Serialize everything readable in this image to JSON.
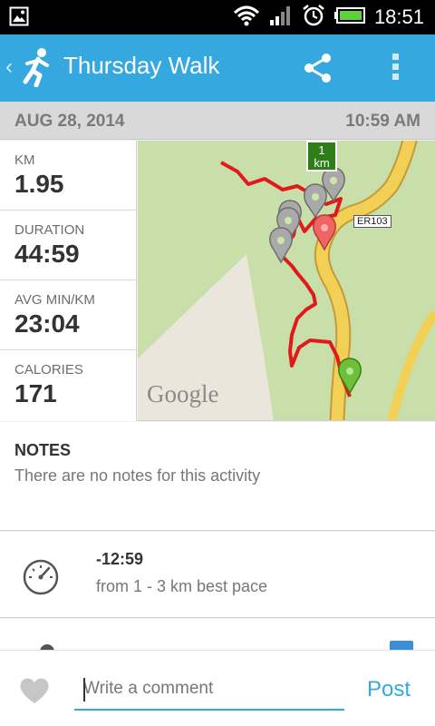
{
  "status_bar": {
    "time": "18:51",
    "icons": [
      "image-icon",
      "wifi-icon",
      "signal-icon",
      "alarm-icon",
      "battery-icon"
    ]
  },
  "action_bar": {
    "title": "Thursday Walk",
    "back_icon": "chevron-left-icon",
    "app_icon": "runner-icon",
    "share_icon": "share-icon",
    "overflow_icon": "overflow-menu-icon",
    "background_color": "#35a8e0"
  },
  "date_bar": {
    "date": "AUG 28, 2014",
    "time": "10:59 AM"
  },
  "stats": [
    {
      "label": "KM",
      "value": "1.95"
    },
    {
      "label": "DURATION",
      "value": "44:59"
    },
    {
      "label": "AVG MIN/KM",
      "value": "23:04"
    },
    {
      "label": "CALORIES",
      "value": "171"
    }
  ],
  "map": {
    "attribution": "Google",
    "road_label": "ER103",
    "km_flag": "1\nkm",
    "route_color": "#e01a1a",
    "start_marker_color": "#6cc03a",
    "end_marker_color": "#f06464"
  },
  "notes": {
    "heading": "NOTES",
    "text": "There are no notes for this activity"
  },
  "best_pace": {
    "icon": "speedometer-icon",
    "value": "-12:59",
    "description": "from 1 - 3 km best pace"
  },
  "comment_bar": {
    "like_icon": "heart-icon",
    "placeholder": "Write a comment",
    "post_label": "Post"
  }
}
